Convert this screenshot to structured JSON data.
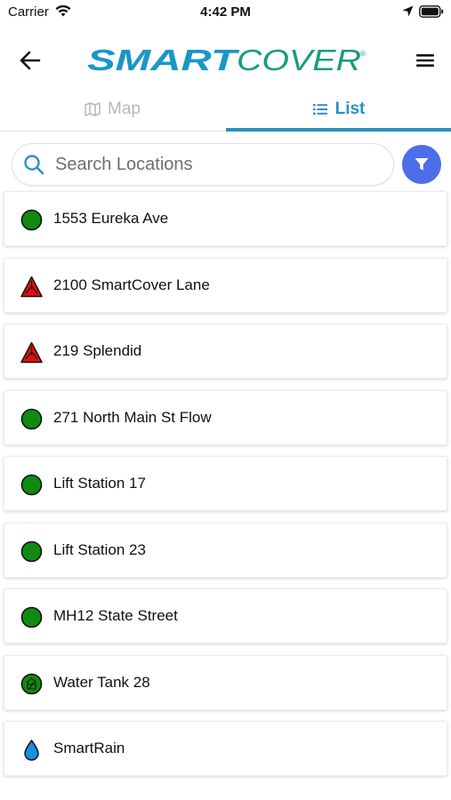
{
  "status_bar": {
    "carrier": "Carrier",
    "time": "4:42 PM"
  },
  "header": {
    "logo_text": "SMARTCOVER",
    "logo_parts": {
      "smart": "SMART",
      "cover": "COVER",
      "mark": "®"
    },
    "logo_colors": {
      "smart": "#1a96c8",
      "cover": "#1a9b80"
    }
  },
  "tabs": [
    {
      "label": "Map",
      "icon": "map-icon",
      "active": false
    },
    {
      "label": "List",
      "icon": "list-icon",
      "active": true
    }
  ],
  "search": {
    "placeholder": "Search Locations",
    "value": ""
  },
  "filter": {
    "icon": "filter-icon",
    "color": "#4d6ee8"
  },
  "colors": {
    "accent": "#2a8fc1",
    "status_ok": "#108a10",
    "status_alarm": "#e31010",
    "rain": "#1a8fe0"
  },
  "locations": [
    {
      "name": "1553 Eureka Ave",
      "status_icon": "green-circle-icon"
    },
    {
      "name": "2100 SmartCover Lane",
      "status_icon": "red-alarm-triangle-icon"
    },
    {
      "name": "219 Splendid",
      "status_icon": "red-alarm-triangle-icon"
    },
    {
      "name": "271 North Main St Flow",
      "status_icon": "green-circle-icon"
    },
    {
      "name": "Lift Station 17",
      "status_icon": "green-circle-icon"
    },
    {
      "name": "Lift Station 23",
      "status_icon": "green-circle-icon"
    },
    {
      "name": "MH12 State Street",
      "status_icon": "green-circle-icon"
    },
    {
      "name": "Water Tank 28",
      "status_icon": "green-tank-icon"
    },
    {
      "name": "SmartRain",
      "status_icon": "water-drop-icon"
    }
  ]
}
